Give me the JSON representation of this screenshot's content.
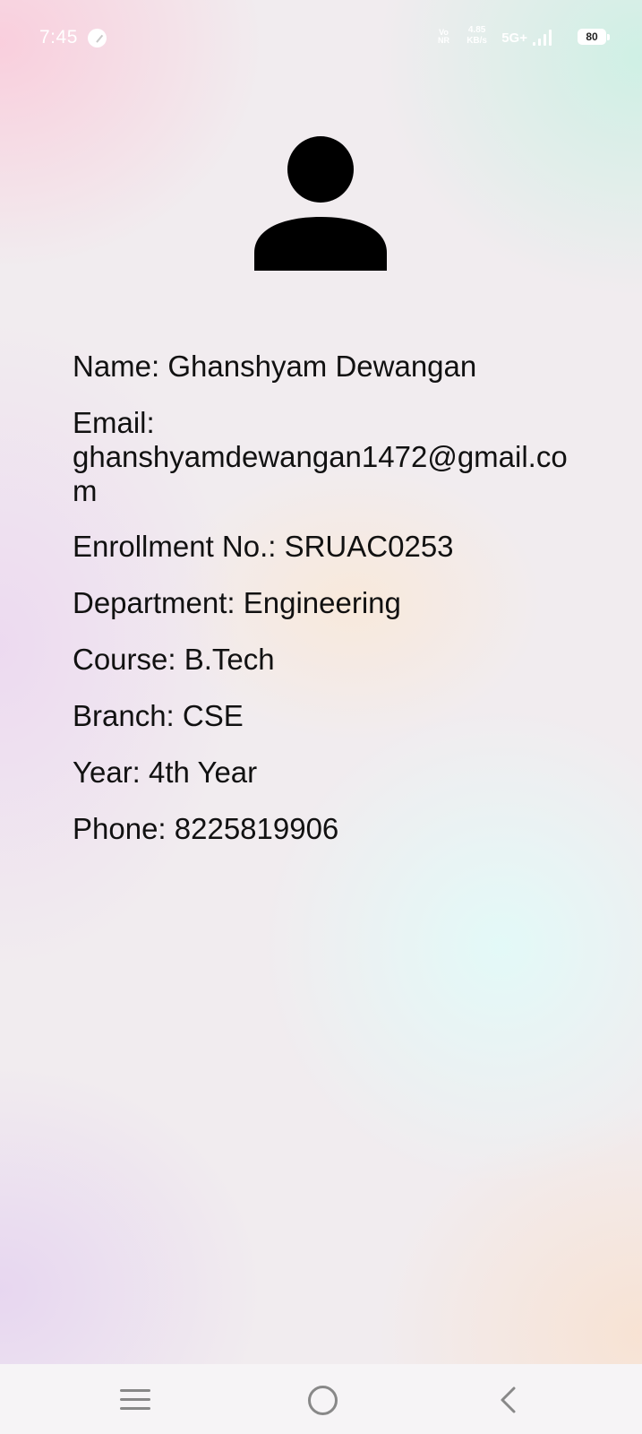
{
  "status_bar": {
    "time": "7:45",
    "volte": "Vo NR",
    "speed_value": "4.85",
    "speed_unit": "KB/s",
    "network": "5G+",
    "battery": "80"
  },
  "profile": {
    "avatar_icon": "person-icon",
    "name": "Name: Ghanshyam Dewangan",
    "email_label": "Email:",
    "email_value": "ghanshyamdewangan1472@gmail.com",
    "enrollment": "Enrollment No.: SRUAC0253",
    "department": "Department: Engineering",
    "course": "Course: B.Tech",
    "branch": "Branch: CSE",
    "year": "Year: 4th Year",
    "phone": "Phone: 8225819906"
  },
  "nav_bar": {
    "menu_icon": "menu-icon",
    "home_icon": "home-circle-icon",
    "back_icon": "back-chevron-icon"
  }
}
